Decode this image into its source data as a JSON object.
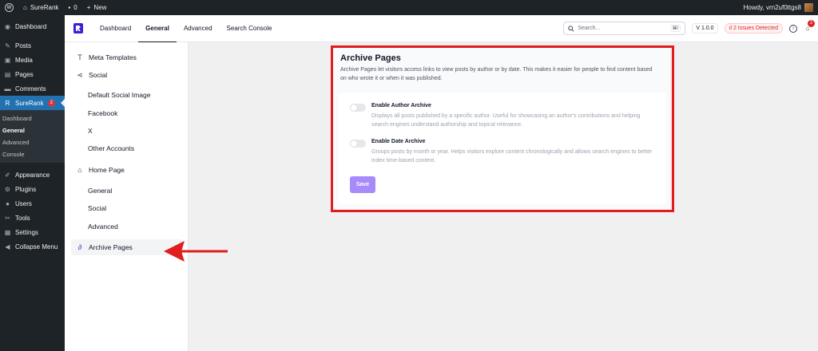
{
  "adminbar": {
    "site_name": "SureRank",
    "comments_count": "0",
    "new_label": "New",
    "howdy": "Howdy, vrn2uf0ttgs8"
  },
  "wp_menu": {
    "items_top": [
      {
        "icon": "dashboard-icon",
        "glyph": "◉",
        "label": "Dashboard"
      },
      {
        "icon": "posts-icon",
        "glyph": "✎",
        "label": "Posts"
      },
      {
        "icon": "media-icon",
        "glyph": "▣",
        "label": "Media"
      },
      {
        "icon": "pages-icon",
        "glyph": "▤",
        "label": "Pages"
      },
      {
        "icon": "comments-icon",
        "glyph": "▬",
        "label": "Comments"
      }
    ],
    "surerank": {
      "label": "SureRank",
      "badge": "2"
    },
    "submenu": [
      "Dashboard",
      "General",
      "Advanced",
      "Console"
    ],
    "items_bottom": [
      {
        "icon": "appearance-icon",
        "glyph": "✐",
        "label": "Appearance"
      },
      {
        "icon": "plugins-icon",
        "glyph": "⚙",
        "label": "Plugins"
      },
      {
        "icon": "users-icon",
        "glyph": "●",
        "label": "Users"
      },
      {
        "icon": "tools-icon",
        "glyph": "✂",
        "label": "Tools"
      },
      {
        "icon": "settings-icon",
        "glyph": "▦",
        "label": "Settings"
      },
      {
        "icon": "collapse-icon",
        "glyph": "◀",
        "label": "Collapse Menu"
      }
    ]
  },
  "topnav": {
    "tabs": [
      "Dashboard",
      "General",
      "Advanced",
      "Search Console"
    ],
    "search_placeholder": "Search...",
    "shortcut": "⌘/",
    "version": "V 1.0.0",
    "issues": "2 Issues Detected",
    "notifications": "2"
  },
  "settings_nav": {
    "meta_templates": "Meta Templates",
    "social": "Social",
    "social_items": [
      "Default Social Image",
      "Facebook",
      "X",
      "Other Accounts"
    ],
    "home_page": "Home Page",
    "home_items": [
      "General",
      "Social",
      "Advanced"
    ],
    "archive_pages": "Archive Pages"
  },
  "main": {
    "title": "Archive Pages",
    "description": "Archive Pages let visitors access links to view posts by author or by date. This makes it easier for people to find content based on who wrote it or when it was published.",
    "options": [
      {
        "label": "Enable Author Archive",
        "description": "Displays all posts published by a specific author. Useful for showcasing an author's contributions and helping search engines understand authorship and topical relevance.",
        "enabled": false
      },
      {
        "label": "Enable Date Archive",
        "description": "Groups posts by month or year. Helps visitors explore content chronologically and allows search engines to better index time-based content.",
        "enabled": false
      }
    ],
    "save_label": "Save"
  },
  "colors": {
    "annotation": "#e11d1d",
    "accent": "#a78bfa",
    "wp_active": "#2271b1"
  }
}
